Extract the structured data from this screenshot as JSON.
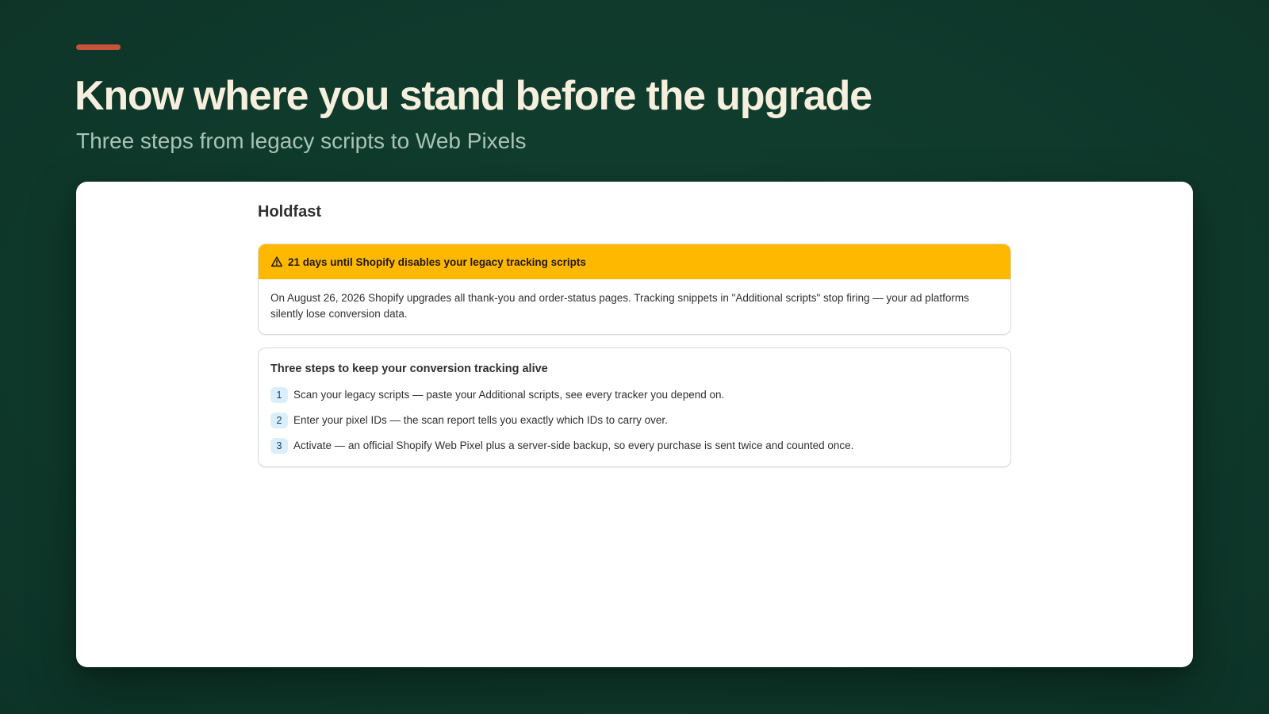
{
  "hero": {
    "title": "Know where you stand before the upgrade",
    "subtitle": "Three steps from legacy scripts to Web Pixels"
  },
  "app": {
    "title": "Holdfast"
  },
  "banner": {
    "icon": "warning-triangle-icon",
    "title": "21 days until Shopify disables your legacy tracking scripts",
    "body": "On August 26, 2026 Shopify upgrades all thank-you and order-status pages. Tracking snippets in \"Additional scripts\" stop firing — your ad platforms silently lose conversion data."
  },
  "steps_card": {
    "title": "Three steps to keep your conversion tracking alive",
    "steps": [
      {
        "number": "1",
        "text": "Scan your legacy scripts — paste your Additional scripts, see every tracker you depend on."
      },
      {
        "number": "2",
        "text": "Enter your pixel IDs — the scan report tells you exactly which IDs to carry over."
      },
      {
        "number": "3",
        "text": "Activate — an official Shopify Web Pixel plus a server-side backup, so every purchase is sent twice and counted once."
      }
    ]
  },
  "colors": {
    "background": "#0f3a2c",
    "accent": "#c8523a",
    "hero_title": "#f6efdd",
    "hero_subtitle": "#a9c3b6",
    "warning": "#ffb800",
    "step_badge": "#dbeefc"
  }
}
